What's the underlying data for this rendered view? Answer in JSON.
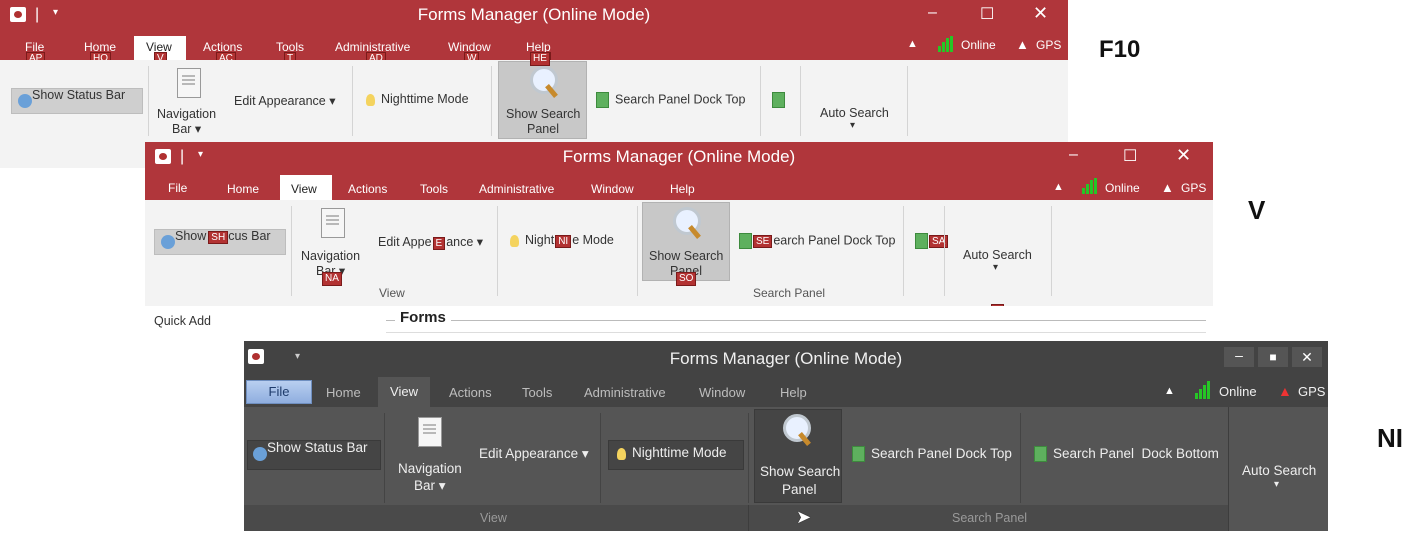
{
  "labels": {
    "f10": "F10",
    "v": "V",
    "ni": "NI"
  },
  "win1": {
    "title": "Forms Manager (Online Mode)",
    "menu": [
      "File",
      "Home",
      "View",
      "Actions",
      "Tools",
      "Administrative",
      "Window",
      "Help"
    ],
    "keytips": [
      "AP",
      "HO",
      "V",
      "AC",
      "T",
      "AD",
      "W",
      "HE"
    ],
    "status": {
      "online": "Online",
      "gps": "GPS"
    },
    "ribbon": {
      "show_status_bar": "Show Status Bar",
      "navigation_bar": "Navigation",
      "navigation_bar2": "Bar ▾",
      "edit_appearance": "Edit Appearance ▾",
      "nighttime_mode": "Nighttime Mode",
      "show_search_panel": "Show Search",
      "show_search_panel2": "Panel",
      "search_panel_dock_top": "Search Panel Dock Top",
      "auto_search": "Auto Search",
      "auto_search_arrow": "▾"
    }
  },
  "win2": {
    "title": "Forms Manager (Online Mode)",
    "menu": [
      "File",
      "Home",
      "View",
      "Actions",
      "Tools",
      "Administrative",
      "Window",
      "Help"
    ],
    "status": {
      "online": "Online",
      "gps": "GPS"
    },
    "ribbon": {
      "show_a": "Show",
      "show_b": "cus Bar",
      "nav1": "Navigation",
      "nav2": "Bar ▾",
      "edit_a": "Edit Appe",
      "edit_b": "ance ▾",
      "night_a": "Night",
      "night_b": "e Mode",
      "search1": "Show Search",
      "search2": "Panel",
      "dock_b": "earch Panel Dock Top",
      "auto_search": "Auto Search",
      "auto_search_arrow": "▾",
      "group_view": "View",
      "group_search": "Search Panel"
    },
    "keytips": {
      "sh": "SH",
      "e": "E",
      "ni": "NI",
      "se": "SE",
      "sa": "SA",
      "na": "NA",
      "so": "SO",
      "a": "A"
    },
    "quick_add": "Quick Add",
    "forms": "Forms"
  },
  "win3": {
    "title": "Forms Manager (Online Mode)",
    "menu": [
      "File",
      "Home",
      "View",
      "Actions",
      "Tools",
      "Administrative",
      "Window",
      "Help"
    ],
    "status": {
      "online": "Online",
      "gps": "GPS"
    },
    "ribbon": {
      "show_status_bar": "Show Status Bar",
      "nav1": "Navigation",
      "nav2": "Bar ▾",
      "edit_appearance": "Edit Appearance ▾",
      "nighttime_mode": "Nighttime Mode",
      "search1": "Show Search",
      "search2": "Panel",
      "dock_top": "Search Panel Dock Top",
      "dock_bottom": "Search Panel  Dock Bottom",
      "auto_search": "Auto Search",
      "auto_search_arrow": "▾",
      "group_view": "View",
      "group_search": "Search Panel"
    }
  }
}
